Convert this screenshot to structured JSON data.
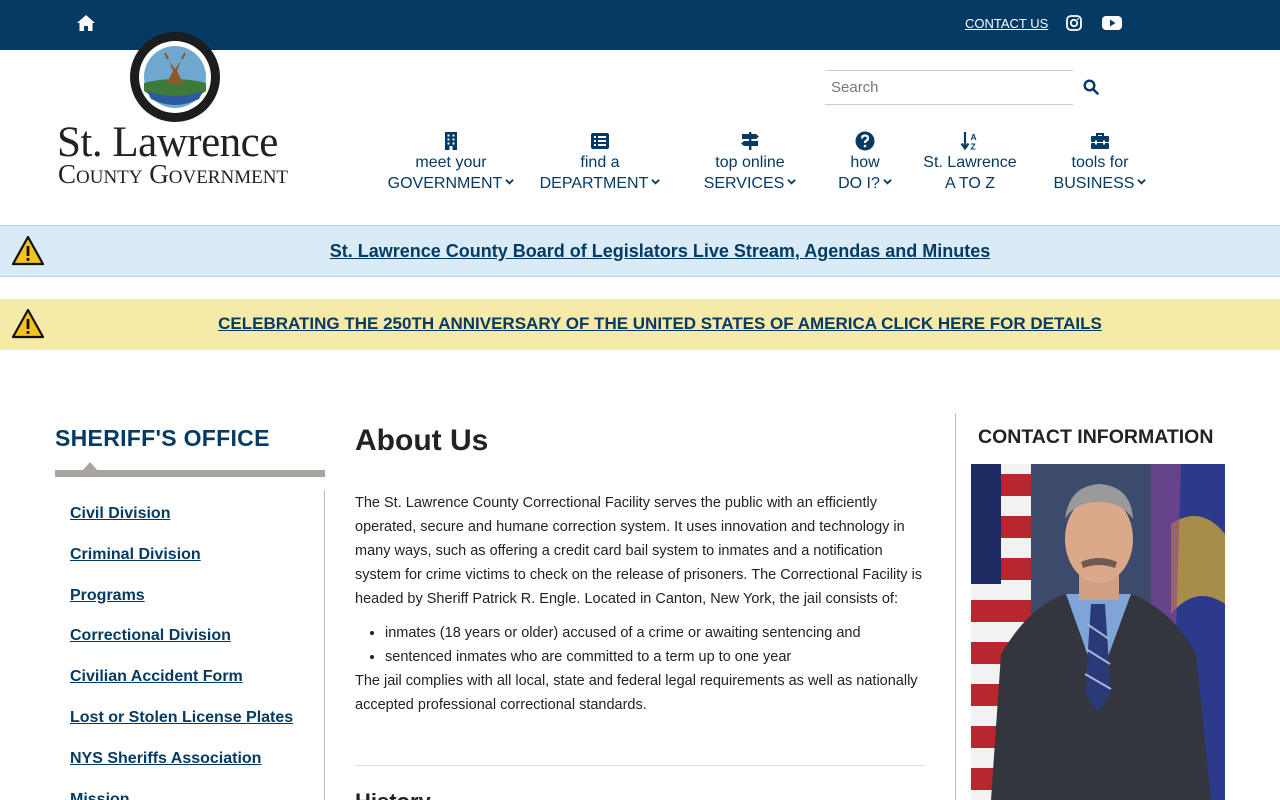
{
  "topbar": {
    "contact_label": "CONTACT US",
    "icons": [
      "home-icon",
      "instagram-icon",
      "youtube-icon"
    ],
    "bg_color": "#043a63"
  },
  "logo": {
    "line1": "St. Lawrence",
    "line2": "County Government"
  },
  "search": {
    "placeholder": "Search",
    "button_icon": "search-icon"
  },
  "nav": [
    {
      "line1": "meet your",
      "line2": "GOVERNMENT",
      "icon": "building-icon",
      "dropdown": true
    },
    {
      "line1": "find a",
      "line2": "DEPARTMENT",
      "icon": "list-icon",
      "dropdown": true
    },
    {
      "line1": "top online",
      "line2": "SERVICES",
      "icon": "signpost-icon",
      "dropdown": true
    },
    {
      "line1": "how",
      "line2": "DO I?",
      "icon": "question-icon",
      "dropdown": true
    },
    {
      "line1": "St. Lawrence",
      "line2": "A TO Z",
      "icon": "sort-alpha-icon",
      "dropdown": false
    },
    {
      "line1": "tools for",
      "line2": "BUSINESS",
      "icon": "toolbox-icon",
      "dropdown": true
    }
  ],
  "alerts": [
    {
      "text": "St. Lawrence County Board of Legislators Live Stream, Agendas and Minutes",
      "icon": "warning-icon",
      "bg": "#d9ebf6"
    },
    {
      "text": "CELEBRATING THE 250TH ANNIVERSARY OF THE UNITED STATES OF AMERICA CLICK HERE FOR DETAILS ",
      "icon": "warning-icon",
      "bg": "#f6eaa8"
    }
  ],
  "sidebar": {
    "title": "SHERIFF'S OFFICE",
    "links": [
      "Civil Division",
      "Criminal Division",
      "Programs",
      "Correctional Division",
      "Civilian Accident Form",
      "Lost or Stolen License Plates",
      "NYS Sheriffs Association",
      "Mission"
    ]
  },
  "main": {
    "title": "About Us",
    "paragraph": "The St. Lawrence County Correctional Facility serves the public with an efficiently operated, secure and humane correction system. It uses innovation and technology in many ways, such as offering a credit card bail system to inmates and a notification system for crime victims to check on the release of prisoners. The Correctional Facility is headed by Sheriff Patrick R. Engle. Located in Canton, New York, the jail consists of:",
    "bullets": [
      "inmates (18 years or older) accused of a crime or awaiting sentencing and",
      "sentenced inmates who are committed to a term up to one year"
    ],
    "closing": "The jail complies with all local, state and federal legal requirements as well as nationally accepted professional correctional standards.",
    "next_heading": "History"
  },
  "contact": {
    "title": "CONTACT INFORMATION"
  },
  "colors": {
    "brand_navy": "#043a63",
    "rule_gray": "#a8a69e"
  }
}
